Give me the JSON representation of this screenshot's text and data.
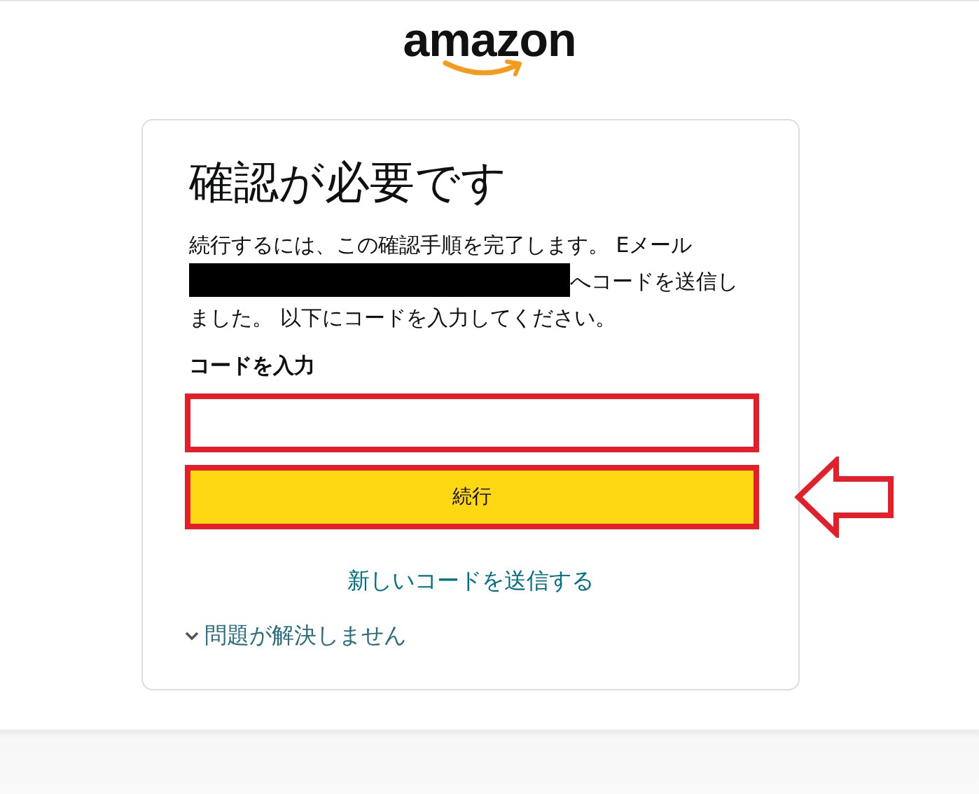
{
  "logo": {
    "text": "amazon"
  },
  "card": {
    "title": "確認が必要です",
    "message": {
      "before": "続行するには、この確認手順を完了します。 Eメール",
      "redacted": true,
      "after": "へコードを送信しました。 以下にコードを入力してください。"
    },
    "code_field": {
      "label": "コードを入力",
      "highlighted": true
    },
    "continue_button": {
      "label": "続行",
      "highlighted": true
    },
    "annotation_arrow": true,
    "resend_link": "新しいコードを送信する",
    "help_toggle": {
      "label": "問題が解決しません",
      "expanded": false
    }
  }
}
